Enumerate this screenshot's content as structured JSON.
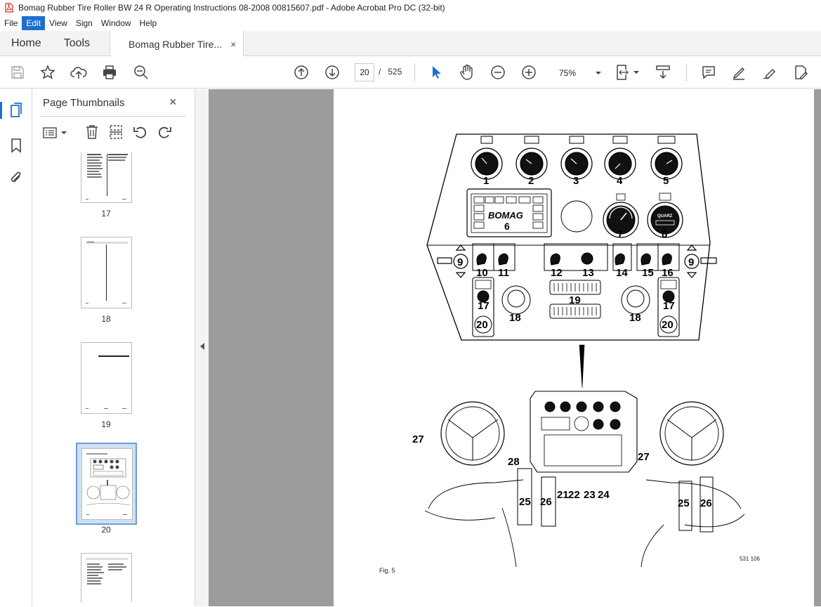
{
  "window": {
    "title": "Bomag Rubber Tire Roller BW 24 R Operating Instructions 08-2008 00815607.pdf - Adobe Acrobat Pro DC (32-bit)"
  },
  "menu": [
    "File",
    "Edit",
    "View",
    "Sign",
    "Window",
    "Help"
  ],
  "tabs": {
    "home": "Home",
    "tools": "Tools",
    "document": "Bomag Rubber Tire...",
    "close": "×"
  },
  "toolbar": {
    "current_page": "20",
    "page_separator": "/",
    "total_pages": "525",
    "zoom": "75%"
  },
  "panel": {
    "title": "Page Thumbnails",
    "close": "×",
    "thumbnails": [
      {
        "label": "17"
      },
      {
        "label": "18"
      },
      {
        "label": "19"
      },
      {
        "label": "20",
        "selected": true
      },
      {
        "label": ""
      }
    ]
  },
  "document": {
    "figure_caption": "Fig. 5",
    "figure_code": "531 106",
    "bomag_logo": "BOMAG",
    "quartz": "QUARZ",
    "callouts_top": [
      "1",
      "2",
      "3",
      "4",
      "5",
      "6",
      "7",
      "8",
      "9",
      "10",
      "11",
      "12",
      "13",
      "14",
      "15",
      "16",
      "9",
      "17",
      "17",
      "18",
      "19",
      "18",
      "20",
      "20"
    ],
    "callouts_bottom": [
      "27",
      "28",
      "27",
      "25",
      "26",
      "21",
      "22",
      "23",
      "24",
      "25",
      "26"
    ]
  },
  "colors": {
    "accent": "#1e6fd0",
    "pdf_red": "#d9261c",
    "doc_bg": "#9c9c9c"
  }
}
